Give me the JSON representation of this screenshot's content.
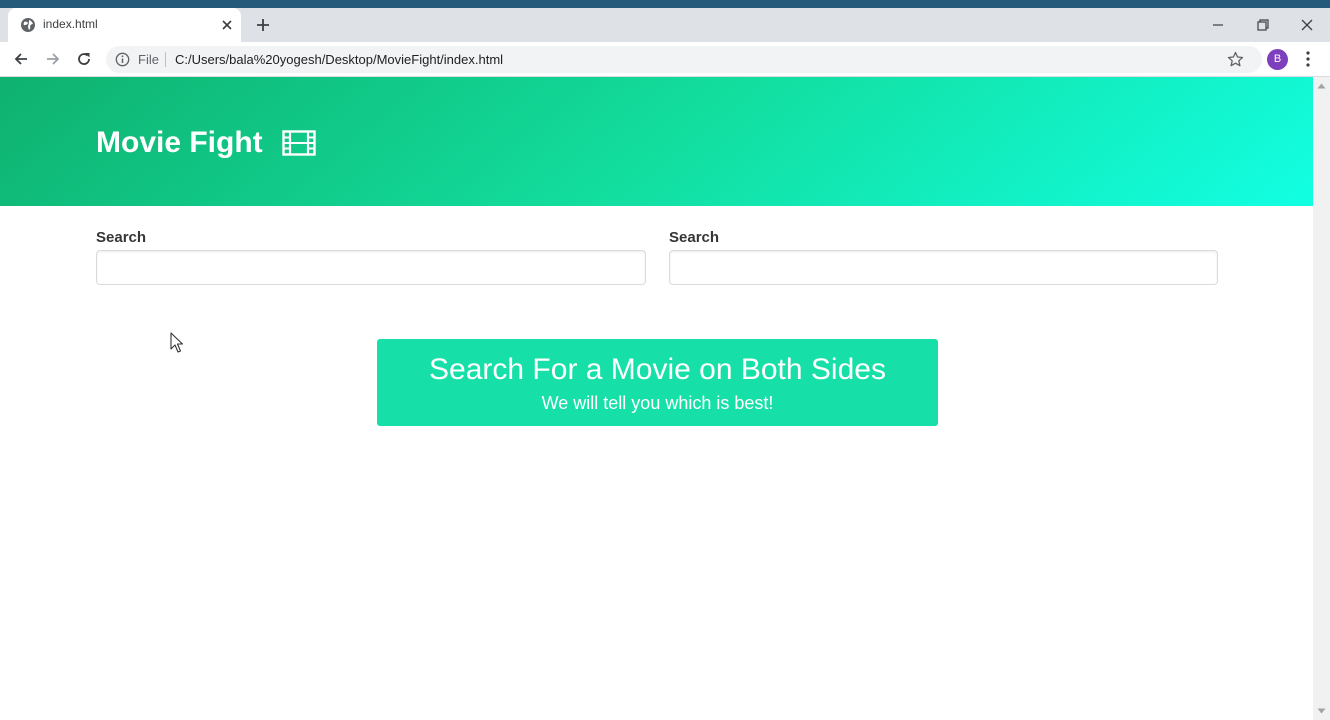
{
  "browser": {
    "tab_title": "index.html",
    "omnibox": {
      "scheme_label": "File",
      "url": "C:/Users/bala%20yogesh/Desktop/MovieFight/index.html"
    },
    "profile_initial": "B",
    "icons": [
      "globe-icon",
      "close-icon",
      "plus-icon",
      "minimize-icon",
      "restore-icon",
      "close-window-icon",
      "back-icon",
      "forward-icon",
      "reload-icon",
      "info-icon",
      "star-icon",
      "kebab-menu-icon"
    ]
  },
  "page": {
    "hero": {
      "title": "Movie Fight",
      "icon": "film-icon",
      "gradient": [
        "#0fb16f",
        "#12dd9d",
        "#12ffe3"
      ]
    },
    "left_search": {
      "label": "Search",
      "value": "",
      "placeholder": ""
    },
    "right_search": {
      "label": "Search",
      "value": "",
      "placeholder": ""
    },
    "notice": {
      "title": "Search For a Movie on Both Sides",
      "subtitle": "We will tell you which is best!",
      "color": "#16e0a8"
    }
  }
}
